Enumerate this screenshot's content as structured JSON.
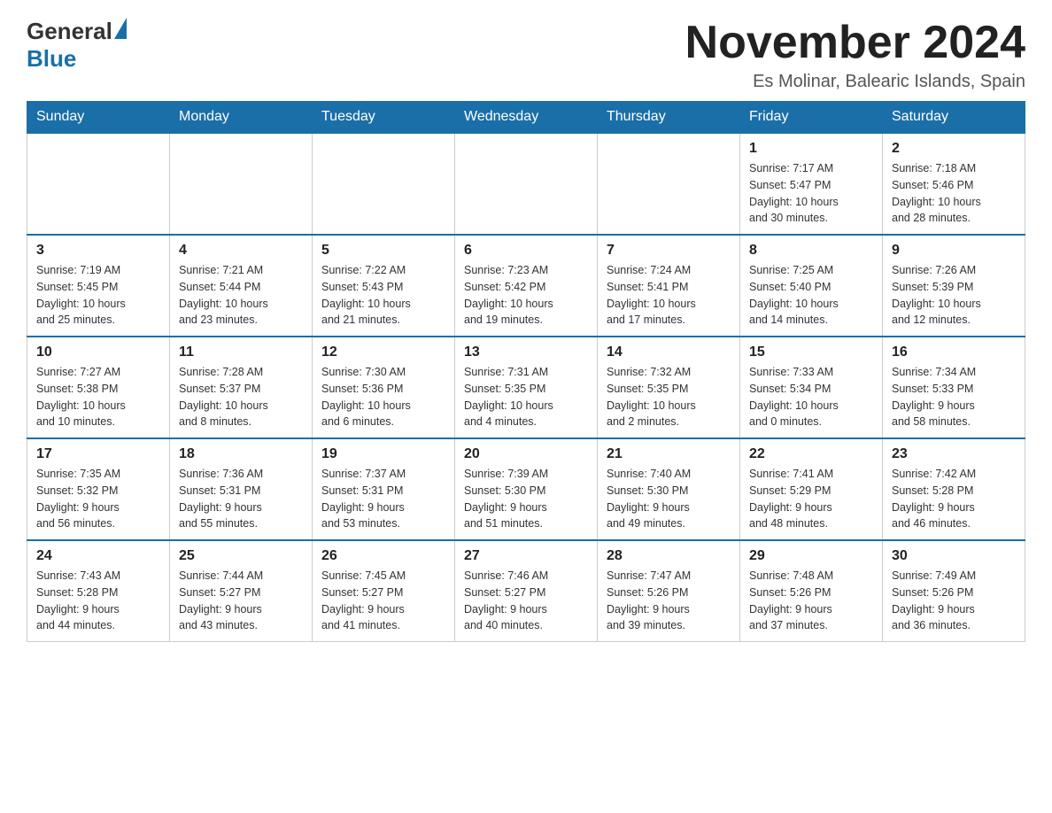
{
  "header": {
    "logo_general": "General",
    "logo_blue": "Blue",
    "month_title": "November 2024",
    "location": "Es Molinar, Balearic Islands, Spain"
  },
  "weekdays": [
    "Sunday",
    "Monday",
    "Tuesday",
    "Wednesday",
    "Thursday",
    "Friday",
    "Saturday"
  ],
  "weeks": [
    [
      {
        "day": "",
        "info": ""
      },
      {
        "day": "",
        "info": ""
      },
      {
        "day": "",
        "info": ""
      },
      {
        "day": "",
        "info": ""
      },
      {
        "day": "",
        "info": ""
      },
      {
        "day": "1",
        "info": "Sunrise: 7:17 AM\nSunset: 5:47 PM\nDaylight: 10 hours\nand 30 minutes."
      },
      {
        "day": "2",
        "info": "Sunrise: 7:18 AM\nSunset: 5:46 PM\nDaylight: 10 hours\nand 28 minutes."
      }
    ],
    [
      {
        "day": "3",
        "info": "Sunrise: 7:19 AM\nSunset: 5:45 PM\nDaylight: 10 hours\nand 25 minutes."
      },
      {
        "day": "4",
        "info": "Sunrise: 7:21 AM\nSunset: 5:44 PM\nDaylight: 10 hours\nand 23 minutes."
      },
      {
        "day": "5",
        "info": "Sunrise: 7:22 AM\nSunset: 5:43 PM\nDaylight: 10 hours\nand 21 minutes."
      },
      {
        "day": "6",
        "info": "Sunrise: 7:23 AM\nSunset: 5:42 PM\nDaylight: 10 hours\nand 19 minutes."
      },
      {
        "day": "7",
        "info": "Sunrise: 7:24 AM\nSunset: 5:41 PM\nDaylight: 10 hours\nand 17 minutes."
      },
      {
        "day": "8",
        "info": "Sunrise: 7:25 AM\nSunset: 5:40 PM\nDaylight: 10 hours\nand 14 minutes."
      },
      {
        "day": "9",
        "info": "Sunrise: 7:26 AM\nSunset: 5:39 PM\nDaylight: 10 hours\nand 12 minutes."
      }
    ],
    [
      {
        "day": "10",
        "info": "Sunrise: 7:27 AM\nSunset: 5:38 PM\nDaylight: 10 hours\nand 10 minutes."
      },
      {
        "day": "11",
        "info": "Sunrise: 7:28 AM\nSunset: 5:37 PM\nDaylight: 10 hours\nand 8 minutes."
      },
      {
        "day": "12",
        "info": "Sunrise: 7:30 AM\nSunset: 5:36 PM\nDaylight: 10 hours\nand 6 minutes."
      },
      {
        "day": "13",
        "info": "Sunrise: 7:31 AM\nSunset: 5:35 PM\nDaylight: 10 hours\nand 4 minutes."
      },
      {
        "day": "14",
        "info": "Sunrise: 7:32 AM\nSunset: 5:35 PM\nDaylight: 10 hours\nand 2 minutes."
      },
      {
        "day": "15",
        "info": "Sunrise: 7:33 AM\nSunset: 5:34 PM\nDaylight: 10 hours\nand 0 minutes."
      },
      {
        "day": "16",
        "info": "Sunrise: 7:34 AM\nSunset: 5:33 PM\nDaylight: 9 hours\nand 58 minutes."
      }
    ],
    [
      {
        "day": "17",
        "info": "Sunrise: 7:35 AM\nSunset: 5:32 PM\nDaylight: 9 hours\nand 56 minutes."
      },
      {
        "day": "18",
        "info": "Sunrise: 7:36 AM\nSunset: 5:31 PM\nDaylight: 9 hours\nand 55 minutes."
      },
      {
        "day": "19",
        "info": "Sunrise: 7:37 AM\nSunset: 5:31 PM\nDaylight: 9 hours\nand 53 minutes."
      },
      {
        "day": "20",
        "info": "Sunrise: 7:39 AM\nSunset: 5:30 PM\nDaylight: 9 hours\nand 51 minutes."
      },
      {
        "day": "21",
        "info": "Sunrise: 7:40 AM\nSunset: 5:30 PM\nDaylight: 9 hours\nand 49 minutes."
      },
      {
        "day": "22",
        "info": "Sunrise: 7:41 AM\nSunset: 5:29 PM\nDaylight: 9 hours\nand 48 minutes."
      },
      {
        "day": "23",
        "info": "Sunrise: 7:42 AM\nSunset: 5:28 PM\nDaylight: 9 hours\nand 46 minutes."
      }
    ],
    [
      {
        "day": "24",
        "info": "Sunrise: 7:43 AM\nSunset: 5:28 PM\nDaylight: 9 hours\nand 44 minutes."
      },
      {
        "day": "25",
        "info": "Sunrise: 7:44 AM\nSunset: 5:27 PM\nDaylight: 9 hours\nand 43 minutes."
      },
      {
        "day": "26",
        "info": "Sunrise: 7:45 AM\nSunset: 5:27 PM\nDaylight: 9 hours\nand 41 minutes."
      },
      {
        "day": "27",
        "info": "Sunrise: 7:46 AM\nSunset: 5:27 PM\nDaylight: 9 hours\nand 40 minutes."
      },
      {
        "day": "28",
        "info": "Sunrise: 7:47 AM\nSunset: 5:26 PM\nDaylight: 9 hours\nand 39 minutes."
      },
      {
        "day": "29",
        "info": "Sunrise: 7:48 AM\nSunset: 5:26 PM\nDaylight: 9 hours\nand 37 minutes."
      },
      {
        "day": "30",
        "info": "Sunrise: 7:49 AM\nSunset: 5:26 PM\nDaylight: 9 hours\nand 36 minutes."
      }
    ]
  ]
}
